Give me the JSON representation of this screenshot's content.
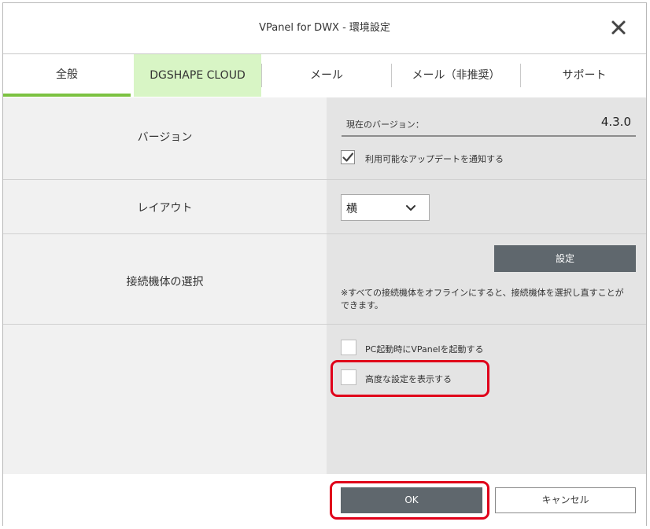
{
  "window": {
    "title": "VPanel for DWX - 環境設定",
    "close_icon": "close-icon"
  },
  "tabs": [
    {
      "label": "全般",
      "selected": true
    },
    {
      "label": "DGSHAPE CLOUD",
      "selected": false
    },
    {
      "label": "メール",
      "selected": false
    },
    {
      "label": "メール（非推奨）",
      "selected": false
    },
    {
      "label": "サポート",
      "selected": false
    }
  ],
  "version": {
    "label": "バージョン",
    "current_label": "現在のバージョン：",
    "current_value": "4.3.0",
    "notify_label": "利用可能なアップデートを通知する",
    "notify_checked": true
  },
  "layout": {
    "label": "レイアウト",
    "selected_value": "横"
  },
  "machine": {
    "label": "接続機体の選択",
    "settings_button": "設定",
    "note": "※すべての接続機体をオフラインにすると、接続機体を選択し直すことができます。"
  },
  "options": {
    "launch_on_startup_label": "PC起動時にVPanelを起動する",
    "launch_on_startup_checked": false,
    "advanced_label": "高度な設定を表示する",
    "advanced_checked": false
  },
  "footer": {
    "ok_label": "OK",
    "cancel_label": "キャンセル"
  },
  "colors": {
    "accent_green": "#7cc241",
    "cloud_tab_bg": "#d8f5c5",
    "dark_button": "#5f676d",
    "highlight_red": "#e0001a"
  }
}
